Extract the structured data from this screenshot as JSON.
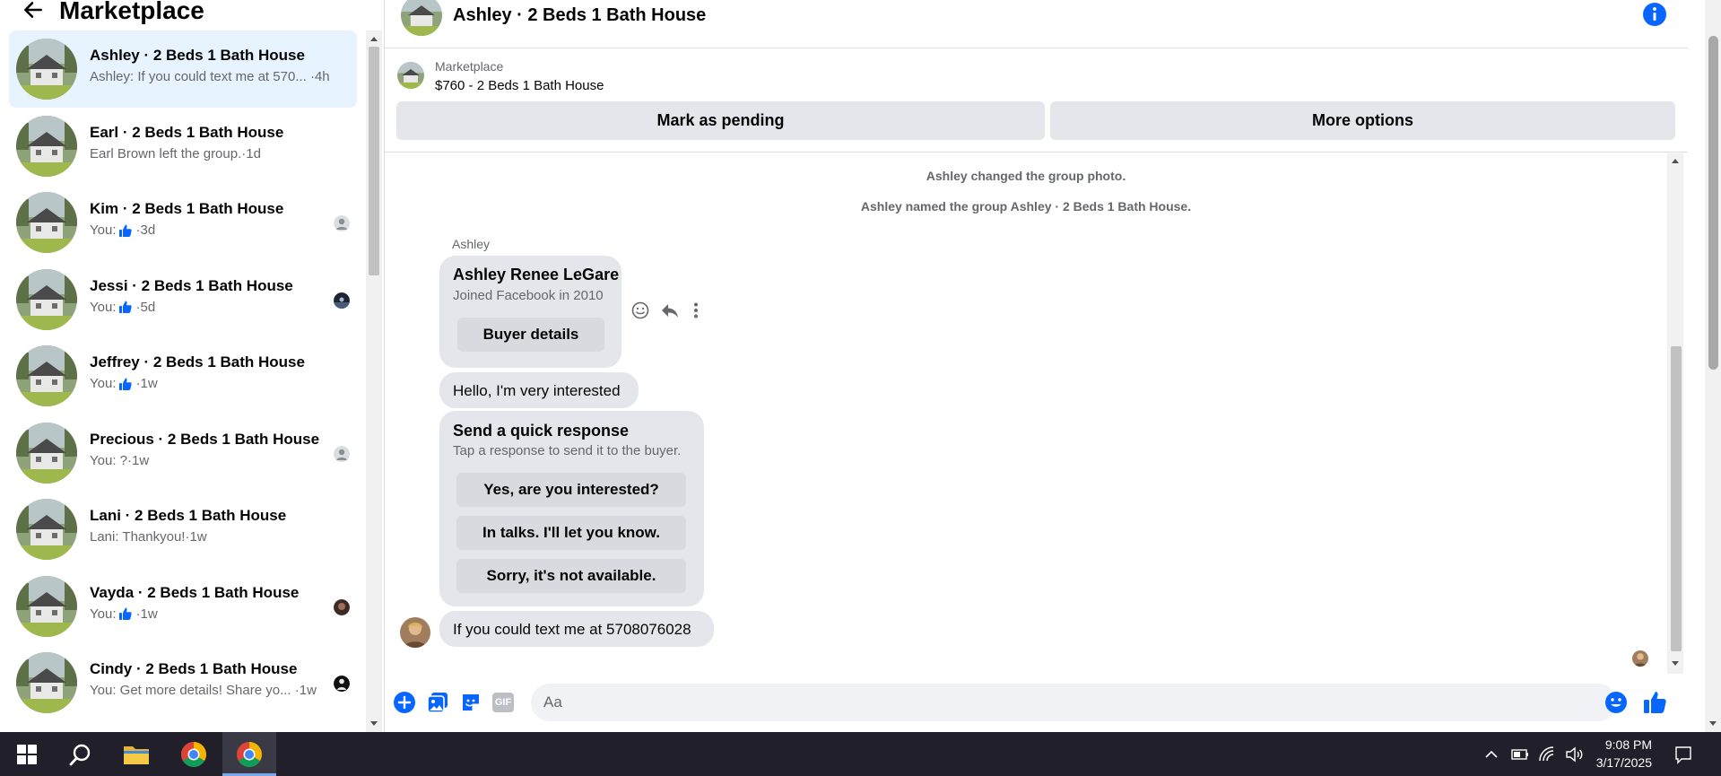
{
  "sidebar": {
    "title": "Marketplace",
    "conversations": [
      {
        "name": "Ashley · 2 Beds 1 Bath House",
        "preview": "Ashley: If you could text me at 570... ·4h",
        "like": false,
        "active": true,
        "read": "none"
      },
      {
        "name": "Earl · 2 Beds 1 Bath House",
        "preview": "Earl Brown left the group.·1d",
        "like": false,
        "active": false,
        "read": "none"
      },
      {
        "name": "Kim · 2 Beds 1 Bath House",
        "prefix": "You:",
        "suffix": "·3d",
        "like": true,
        "active": false,
        "read": "default"
      },
      {
        "name": "Jessi · 2 Beds 1 Bath House",
        "prefix": "You:",
        "suffix": "·5d",
        "like": true,
        "active": false,
        "read": "photo-dark"
      },
      {
        "name": "Jeffrey · 2 Beds 1 Bath House",
        "prefix": "You:",
        "suffix": "·1w",
        "like": true,
        "active": false,
        "read": "none"
      },
      {
        "name": "Precious · 2 Beds 1 Bath House",
        "preview": "You: ?·1w",
        "like": false,
        "active": false,
        "read": "default"
      },
      {
        "name": "Lani · 2 Beds 1 Bath House",
        "preview": "Lani: Thankyou!·1w",
        "like": false,
        "active": false,
        "read": "none"
      },
      {
        "name": "Vayda · 2 Beds 1 Bath House",
        "prefix": "You:",
        "suffix": "·1w",
        "like": true,
        "active": false,
        "read": "photo-face"
      },
      {
        "name": "Cindy · 2 Beds 1 Bath House",
        "preview": "You: Get more details! Share yo... ·1w",
        "like": false,
        "active": false,
        "read": "photo-person"
      }
    ]
  },
  "chat": {
    "title": "Ashley · 2 Beds 1 Bath House",
    "listing_label": "Marketplace",
    "listing_price": "$760 - 2 Beds 1 Bath House",
    "mark_pending_label": "Mark as pending",
    "more_options_label": "More options",
    "system_messages": [
      "Ashley changed the group photo.",
      "Ashley named the group Ashley · 2 Beds 1 Bath House."
    ],
    "sender_name": "Ashley",
    "profile_card": {
      "name": "Ashley Renee LeGare",
      "subtitle": "Joined Facebook in 2010",
      "button": "Buyer details"
    },
    "message_1": "Hello, I'm very interested",
    "quick_response": {
      "title": "Send a quick response",
      "subtitle": "Tap a response to send it to the buyer.",
      "options": [
        "Yes, are you interested?",
        "In talks. I'll let you know.",
        "Sorry, it's not available."
      ]
    },
    "message_2": "If you could text me at 5708076028",
    "composer_placeholder": "Aa",
    "gif_label": "GIF"
  },
  "taskbar": {
    "time": "9:08 PM",
    "date": "3/17/2025"
  },
  "colors": {
    "accent": "#0866ff",
    "bubble": "#e4e6eb",
    "active_row": "#e7f3ff",
    "taskbar": "#201f2a"
  }
}
